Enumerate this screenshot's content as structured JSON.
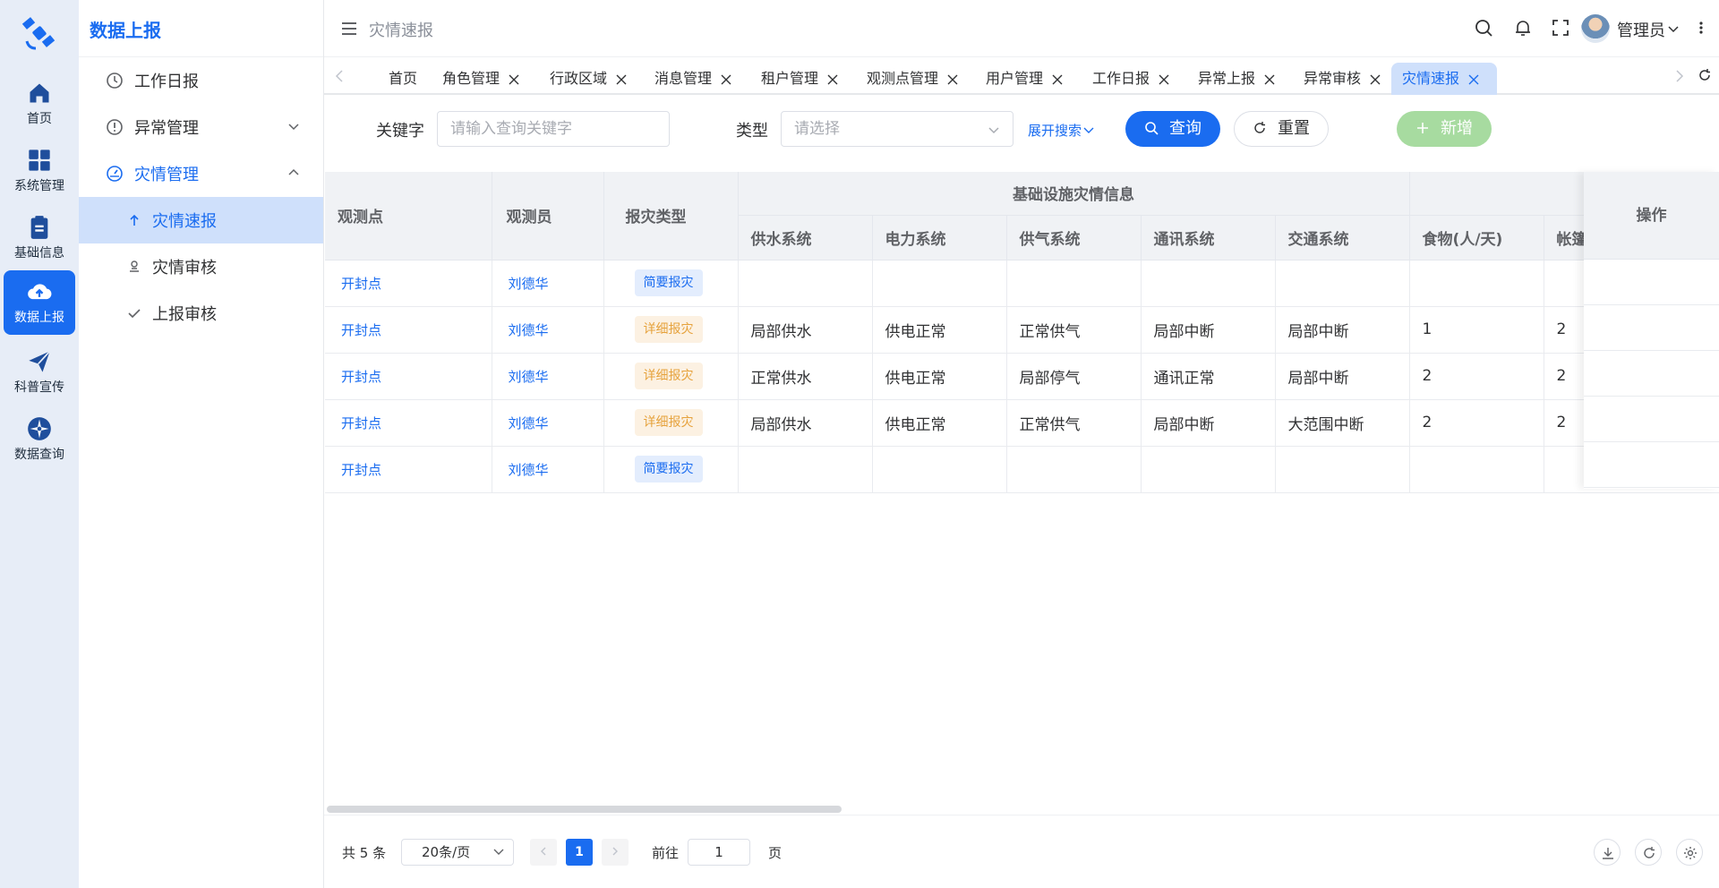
{
  "rail": [
    {
      "label": "首页",
      "icon": "home-icon"
    },
    {
      "label": "系统管理",
      "icon": "grid-icon"
    },
    {
      "label": "基础信息",
      "icon": "clipboard-icon"
    },
    {
      "label": "数据上报",
      "icon": "cloud-upload-icon",
      "active": true
    },
    {
      "label": "科普宣传",
      "icon": "paper-plane-icon"
    },
    {
      "label": "数据查询",
      "icon": "compass-icon"
    }
  ],
  "submenu": {
    "title": "数据上报",
    "items": [
      {
        "label": "工作日报"
      },
      {
        "label": "异常管理"
      },
      {
        "label": "灾情管理"
      },
      {
        "label": "灾情速报"
      },
      {
        "label": "灾情审核"
      },
      {
        "label": "上报审核"
      }
    ]
  },
  "header": {
    "title": "灾情速报",
    "user": "管理员"
  },
  "tabs": [
    "首页",
    "角色管理",
    "行政区域",
    "消息管理",
    "租户管理",
    "观测点管理",
    "用户管理",
    "工作日报",
    "异常上报",
    "异常审核",
    "灾情速报"
  ],
  "search": {
    "keyword_label": "关键字",
    "keyword_placeholder": "请输入查询关键字",
    "type_label": "类型",
    "type_placeholder": "请选择",
    "expand": "展开搜索",
    "query": "查询",
    "reset": "重置",
    "add": "新增"
  },
  "table": {
    "headers": {
      "station": "观测点",
      "observer": "观测员",
      "type": "报灾类型",
      "group": "基础设施灾情信息",
      "water": "供水系统",
      "power": "电力系统",
      "gas": "供气系统",
      "comm": "通讯系统",
      "traffic": "交通系统",
      "food": "食物(人/天)",
      "tent": "帐篷",
      "ops": "操作"
    },
    "rows": [
      {
        "station": "开封点",
        "observer": "刘德华",
        "type": "简要报灾",
        "kind": "blue",
        "water": "",
        "power": "",
        "gas": "",
        "comm": "",
        "traffic": "",
        "food": "",
        "tent": ""
      },
      {
        "station": "开封点",
        "observer": "刘德华",
        "type": "详细报灾",
        "kind": "orange",
        "water": "局部供水",
        "power": "供电正常",
        "gas": "正常供气",
        "comm": "局部中断",
        "traffic": "局部中断",
        "food": "1",
        "tent": "2"
      },
      {
        "station": "开封点",
        "observer": "刘德华",
        "type": "详细报灾",
        "kind": "orange",
        "water": "正常供水",
        "power": "供电正常",
        "gas": "局部停气",
        "comm": "通讯正常",
        "traffic": "局部中断",
        "food": "2",
        "tent": "2"
      },
      {
        "station": "开封点",
        "observer": "刘德华",
        "type": "详细报灾",
        "kind": "orange",
        "water": "局部供水",
        "power": "供电正常",
        "gas": "正常供气",
        "comm": "局部中断",
        "traffic": "大范围中断",
        "food": "2",
        "tent": "2"
      },
      {
        "station": "开封点",
        "observer": "刘德华",
        "type": "简要报灾",
        "kind": "blue",
        "water": "",
        "power": "",
        "gas": "",
        "comm": "",
        "traffic": "",
        "food": "",
        "tent": ""
      }
    ]
  },
  "pagination": {
    "total": "共 5 条",
    "page_size": "20条/页",
    "current": "1",
    "goto_label": "前往",
    "goto_value": "1",
    "page_unit": "页"
  }
}
